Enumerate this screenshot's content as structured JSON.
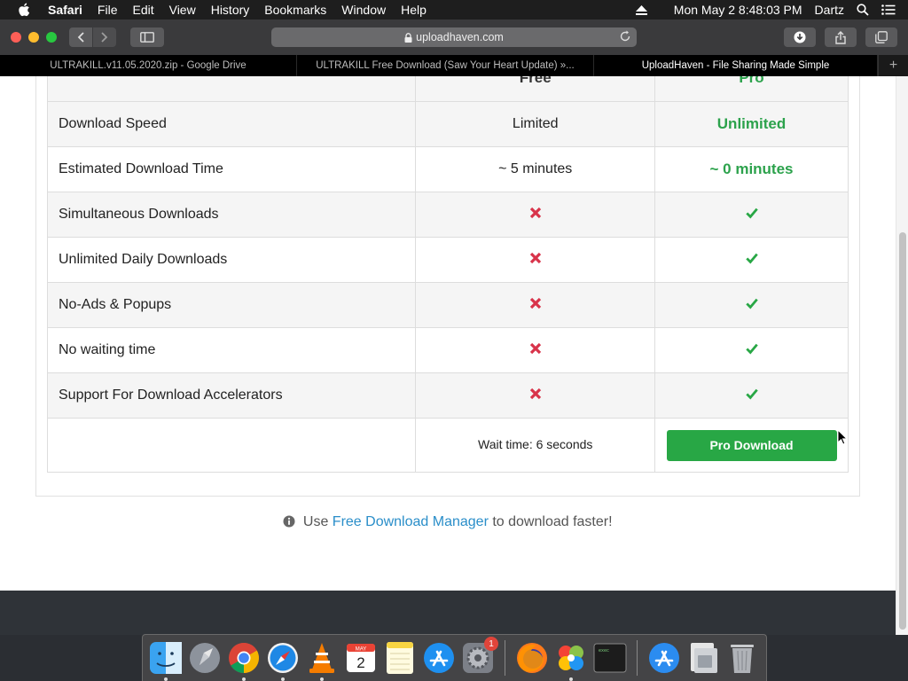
{
  "menubar": {
    "app_name": "Safari",
    "items": [
      "File",
      "Edit",
      "View",
      "History",
      "Bookmarks",
      "Window",
      "Help"
    ],
    "clock": "Mon May 2  8:48:03 PM",
    "user": "Dartz"
  },
  "toolbar": {
    "url": "uploadhaven.com"
  },
  "tabs": [
    {
      "label": "ULTRAKILL.v11.05.2020.zip - Google Drive",
      "active": false
    },
    {
      "label": "ULTRAKILL Free Download (Saw Your Heart Update) »...",
      "active": false
    },
    {
      "label": "UploadHaven - File Sharing Made Simple",
      "active": true
    }
  ],
  "table": {
    "header": {
      "free": "Free",
      "pro": "Pro"
    },
    "rows": [
      {
        "feature": "Download Speed",
        "free": "Limited",
        "pro": "Unlimited"
      },
      {
        "feature": "Estimated Download Time",
        "free": "~ 5 minutes",
        "pro": "~ 0 minutes"
      },
      {
        "feature": "Simultaneous Downloads",
        "free": "x",
        "pro": "check"
      },
      {
        "feature": "Unlimited Daily Downloads",
        "free": "x",
        "pro": "check"
      },
      {
        "feature": "No-Ads & Popups",
        "free": "x",
        "pro": "check"
      },
      {
        "feature": "No waiting time",
        "free": "x",
        "pro": "check"
      },
      {
        "feature": "Support For Download Accelerators",
        "free": "x",
        "pro": "check"
      }
    ],
    "wait_text": "Wait time: 6 seconds",
    "pro_button": "Pro Download"
  },
  "fdm": {
    "prefix": "Use",
    "link": "Free Download Manager",
    "suffix": "to download faster!"
  },
  "dock": {
    "calendar_month": "MAY",
    "calendar_day": "2",
    "sysprefs_badge": "1",
    "terminal_text": "exec"
  },
  "colors": {
    "green": "#28a745",
    "red": "#d8334a",
    "link": "#2a8ec9"
  }
}
